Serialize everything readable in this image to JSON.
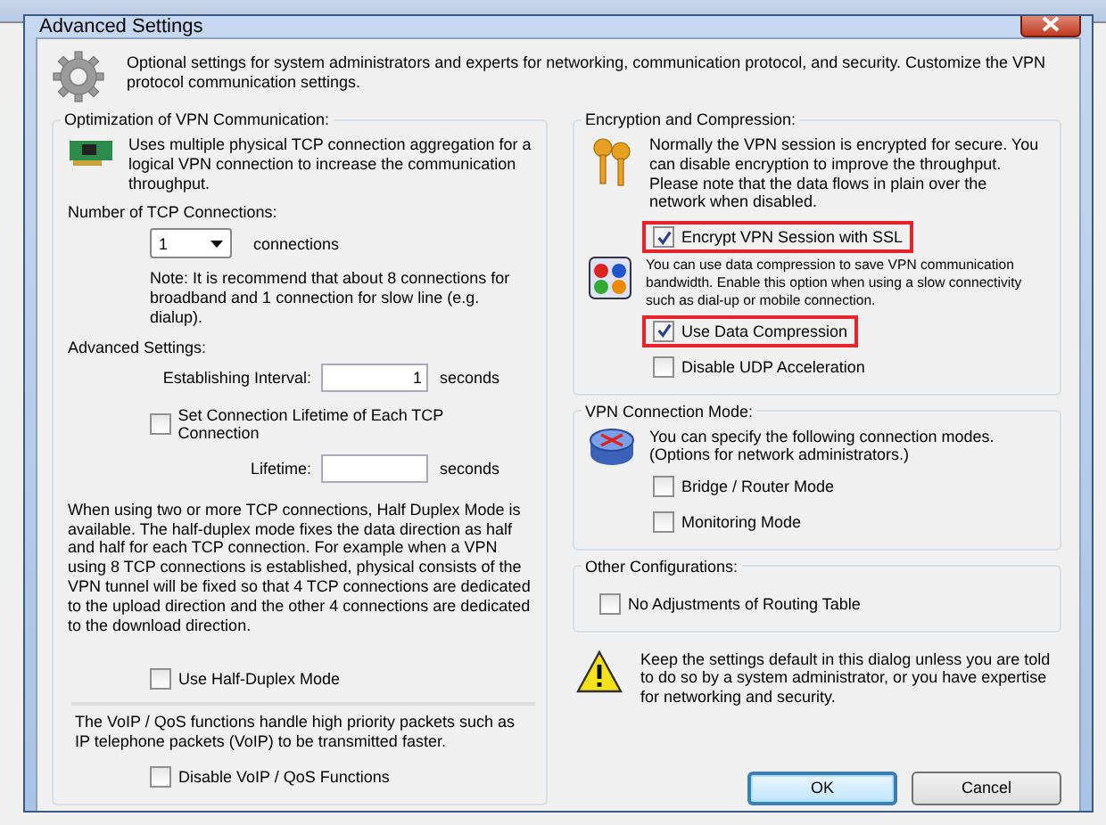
{
  "dialog": {
    "title": "Advanced Settings"
  },
  "header": {
    "text": "Optional settings for system administrators and experts for networking, communication protocol, and security. Customize the VPN protocol communication settings."
  },
  "optimization": {
    "title": "Optimization of VPN Communication:",
    "description": "Uses multiple physical TCP connection aggregation for a logical VPN connection to increase the communication throughput.",
    "tcp_label": "Number of TCP Connections:",
    "tcp_count": "1",
    "tcp_unit": "connections",
    "note": "Note: It is recommend that about 8 connections for broadband and 1 connection for slow line (e.g. dialup).",
    "advanced_label": "Advanced Settings:",
    "interval": {
      "label": "Establishing Interval:",
      "value": "1",
      "unit": "seconds"
    },
    "lifetime_checkbox": {
      "label": "Set Connection Lifetime of Each TCP Connection",
      "checked": false,
      "highlighted": false
    },
    "lifetime": {
      "label": "Lifetime:",
      "unit": "seconds"
    },
    "half_duplex_text": "When using two or more TCP connections, Half Duplex Mode is available. The half-duplex mode fixes the data direction as half and half for each TCP connection. For example when a VPN using 8 TCP connections is established, physical consists of the VPN tunnel will be fixed so that 4 TCP connections are dedicated to the upload direction and the other 4 connections are dedicated to the download direction.",
    "half_duplex_checkbox": {
      "label": "Use Half-Duplex Mode",
      "checked": false,
      "highlighted": false
    },
    "voip_text": "The VoIP / QoS functions handle high priority packets such as IP telephone packets (VoIP) to be transmitted faster.",
    "voip_checkbox": {
      "label": "Disable VoIP / QoS Functions",
      "checked": false,
      "highlighted": false
    }
  },
  "encryption": {
    "title": "Encryption and Compression:",
    "description": "Normally the VPN session is encrypted for secure. You can disable encryption to improve the throughput. Please note that the data flows in plain over the network when disabled.",
    "ssl_checkbox": {
      "label": "Encrypt VPN Session with SSL",
      "checked": true,
      "highlighted": true
    },
    "compression_text": "You can use data compression to save VPN communication bandwidth. Enable this option when using a slow connectivity such as dial-up or mobile connection.",
    "compression_checkbox": {
      "label": "Use Data Compression",
      "checked": true,
      "highlighted": true
    },
    "udp_checkbox": {
      "label": "Disable UDP Acceleration",
      "checked": false,
      "highlighted": false
    }
  },
  "connection_mode": {
    "title": "VPN Connection Mode:",
    "description": "You can specify the following connection modes. (Options for network administrators.)",
    "options": [
      {
        "label": "Bridge / Router Mode",
        "checked": false,
        "highlighted": false
      },
      {
        "label": "Monitoring Mode",
        "checked": false,
        "highlighted": false
      }
    ]
  },
  "other": {
    "title": "Other Configurations:",
    "options": [
      {
        "label": "No Adjustments of Routing Table",
        "checked": false,
        "highlighted": false
      }
    ]
  },
  "warning": "Keep the settings default in this dialog unless you are told to do so by a system administrator, or you have expertise for networking and security.",
  "buttons": [
    {
      "label": "OK",
      "kind": "default"
    },
    {
      "label": "Cancel",
      "kind": "normal"
    }
  ]
}
